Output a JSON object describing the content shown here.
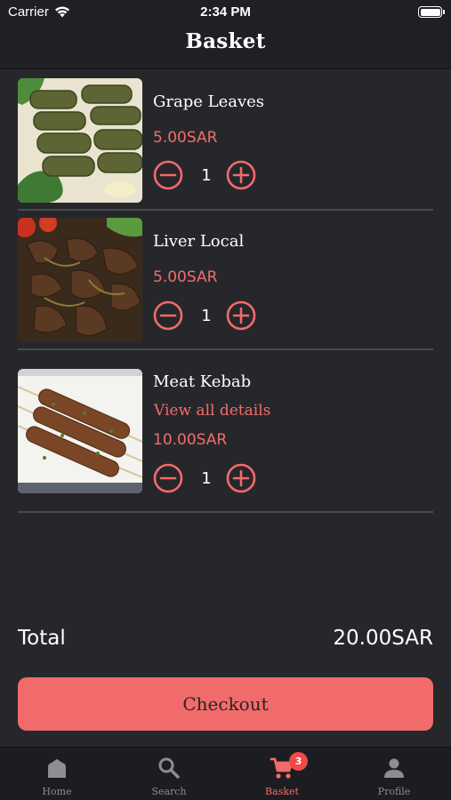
{
  "status_bar": {
    "carrier": "Carrier",
    "time": "2:34 PM"
  },
  "header": {
    "title": "Basket"
  },
  "accent_color": "#f26b6b",
  "items": [
    {
      "name": "Grape Leaves",
      "price": "5.00SAR",
      "quantity": "1",
      "image": "grape-leaves-photo"
    },
    {
      "name": "Liver Local",
      "price": "5.00SAR",
      "quantity": "1",
      "image": "liver-photo"
    },
    {
      "name": "Meat Kebab",
      "details_link": "View all details",
      "price": "10.00SAR",
      "quantity": "1",
      "image": "kebab-photo"
    }
  ],
  "summary": {
    "total_label": "Total",
    "total_value": "20.00SAR"
  },
  "checkout": {
    "label": "Checkout"
  },
  "tabbar": {
    "tabs": [
      {
        "label": "Home",
        "icon": "home-icon"
      },
      {
        "label": "Search",
        "icon": "search-icon"
      },
      {
        "label": "Basket",
        "icon": "cart-icon",
        "badge": "3",
        "active": true
      },
      {
        "label": "Profile",
        "icon": "person-icon"
      }
    ]
  }
}
